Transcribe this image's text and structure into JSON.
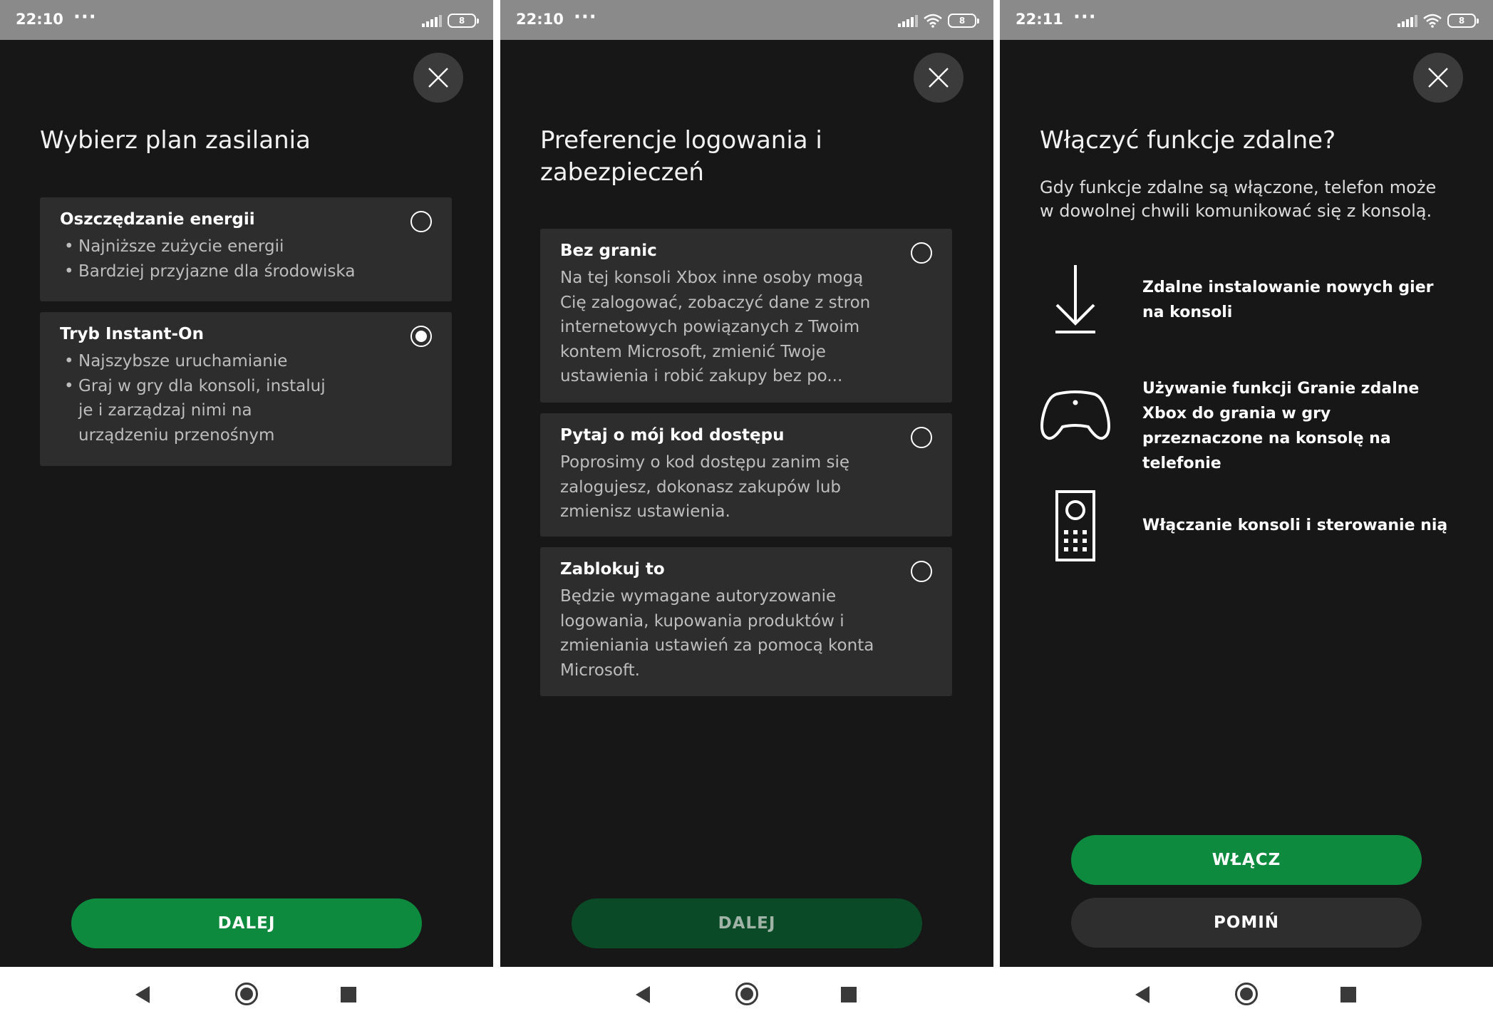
{
  "screens": [
    {
      "status": {
        "time": "22:10",
        "dots": "···",
        "battery": "8"
      },
      "title": "Wybierz plan zasilania",
      "options": [
        {
          "title": "Oszczędzanie energii",
          "bullets": [
            "Najniższe zużycie energii",
            "Bardziej przyjazne dla środowiska"
          ],
          "selected": false
        },
        {
          "title": "Tryb Instant-On",
          "bullets": [
            "Najszybsze uruchamianie",
            "Graj w gry dla konsoli, instaluj je i zarządzaj nimi na urządzeniu przenośnym"
          ],
          "selected": true
        }
      ],
      "button": "DALEJ"
    },
    {
      "status": {
        "time": "22:10",
        "dots": "···",
        "battery": "8"
      },
      "title": "Preferencje logowania i zabezpieczeń",
      "options": [
        {
          "title": "Bez granic",
          "text": "Na tej konsoli Xbox inne osoby mogą Cię zalogować, zobaczyć dane z stron internetowych powiązanych z Twoim kontem Microsoft, zmienić Twoje ustawienia i robić zakupy bez po...",
          "selected": false
        },
        {
          "title": "Pytaj o mój kod dostępu",
          "text": "Poprosimy o kod dostępu zanim się zalogujesz, dokonasz zakupów lub zmienisz ustawienia.",
          "selected": false
        },
        {
          "title": "Zablokuj to",
          "text": "Będzie wymagane autoryzowanie logowania, kupowania produktów i zmieniania ustawień za pomocą konta Microsoft.",
          "selected": false
        }
      ],
      "button": "DALEJ"
    },
    {
      "status": {
        "time": "22:11",
        "dots": "···",
        "battery": "8"
      },
      "title": "Włączyć funkcje zdalne?",
      "description": "Gdy funkcje zdalne są włączone, telefon może w dowolnej chwili komunikować się z konsolą.",
      "features": [
        {
          "icon": "download-icon",
          "text": "Zdalne instalowanie nowych gier na konsoli"
        },
        {
          "icon": "gamepad-icon",
          "text": "Używanie funkcji Granie zdalne Xbox do grania w gry przeznaczone na konsolę na telefonie"
        },
        {
          "icon": "remote-icon",
          "text": "Włączanie konsoli i sterowanie nią"
        }
      ],
      "primary_button": "WŁĄCZ",
      "secondary_button": "POMIŃ"
    }
  ],
  "colors": {
    "background": "#171717",
    "card": "#2d2d2d",
    "accent": "#0e8a3e",
    "accent_disabled": "#0b4a27",
    "statusbar": "#8a8a8a"
  }
}
